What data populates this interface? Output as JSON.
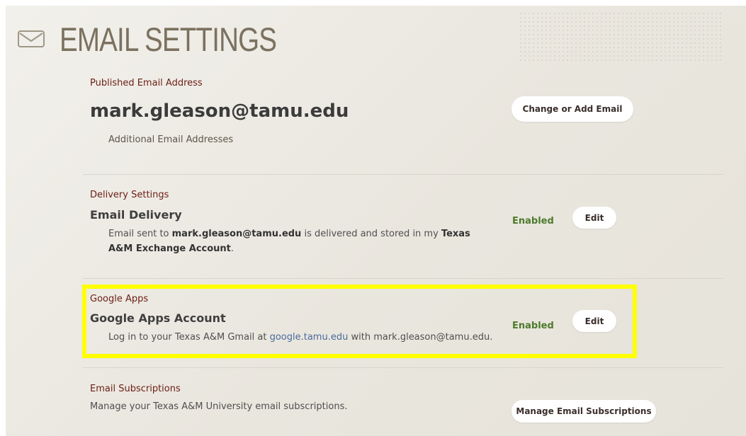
{
  "header": {
    "title": "EMAIL SETTINGS",
    "icon": "envelope-icon"
  },
  "published": {
    "label": "Published Email Address",
    "email": "mark.gleason@tamu.edu",
    "additional_link": "Additional Email Addresses",
    "button": "Change or Add Email"
  },
  "delivery": {
    "label": "Delivery Settings",
    "title": "Email Delivery",
    "desc_pre": "Email sent to ",
    "desc_email": "mark.gleason@tamu.edu",
    "desc_mid": " is delivered and stored in my ",
    "desc_account": "Texas A&M Exchange Account",
    "desc_end": ".",
    "status": "Enabled",
    "button": "Edit"
  },
  "google": {
    "label": "Google Apps",
    "title": "Google Apps Account",
    "desc_pre": "Log in to your Texas A&M Gmail at ",
    "desc_link": "google.tamu.edu",
    "desc_post": " with mark.gleason@tamu.edu.",
    "status": "Enabled",
    "button": "Edit"
  },
  "subscriptions": {
    "label": "Email Subscriptions",
    "desc": "Manage your Texas A&M University email subscriptions.",
    "button": "Manage Email Subscriptions"
  },
  "colors": {
    "label": "#6b1e14",
    "status": "#4e7a2d",
    "highlight": "#ffff00",
    "title": "#7b715f"
  }
}
